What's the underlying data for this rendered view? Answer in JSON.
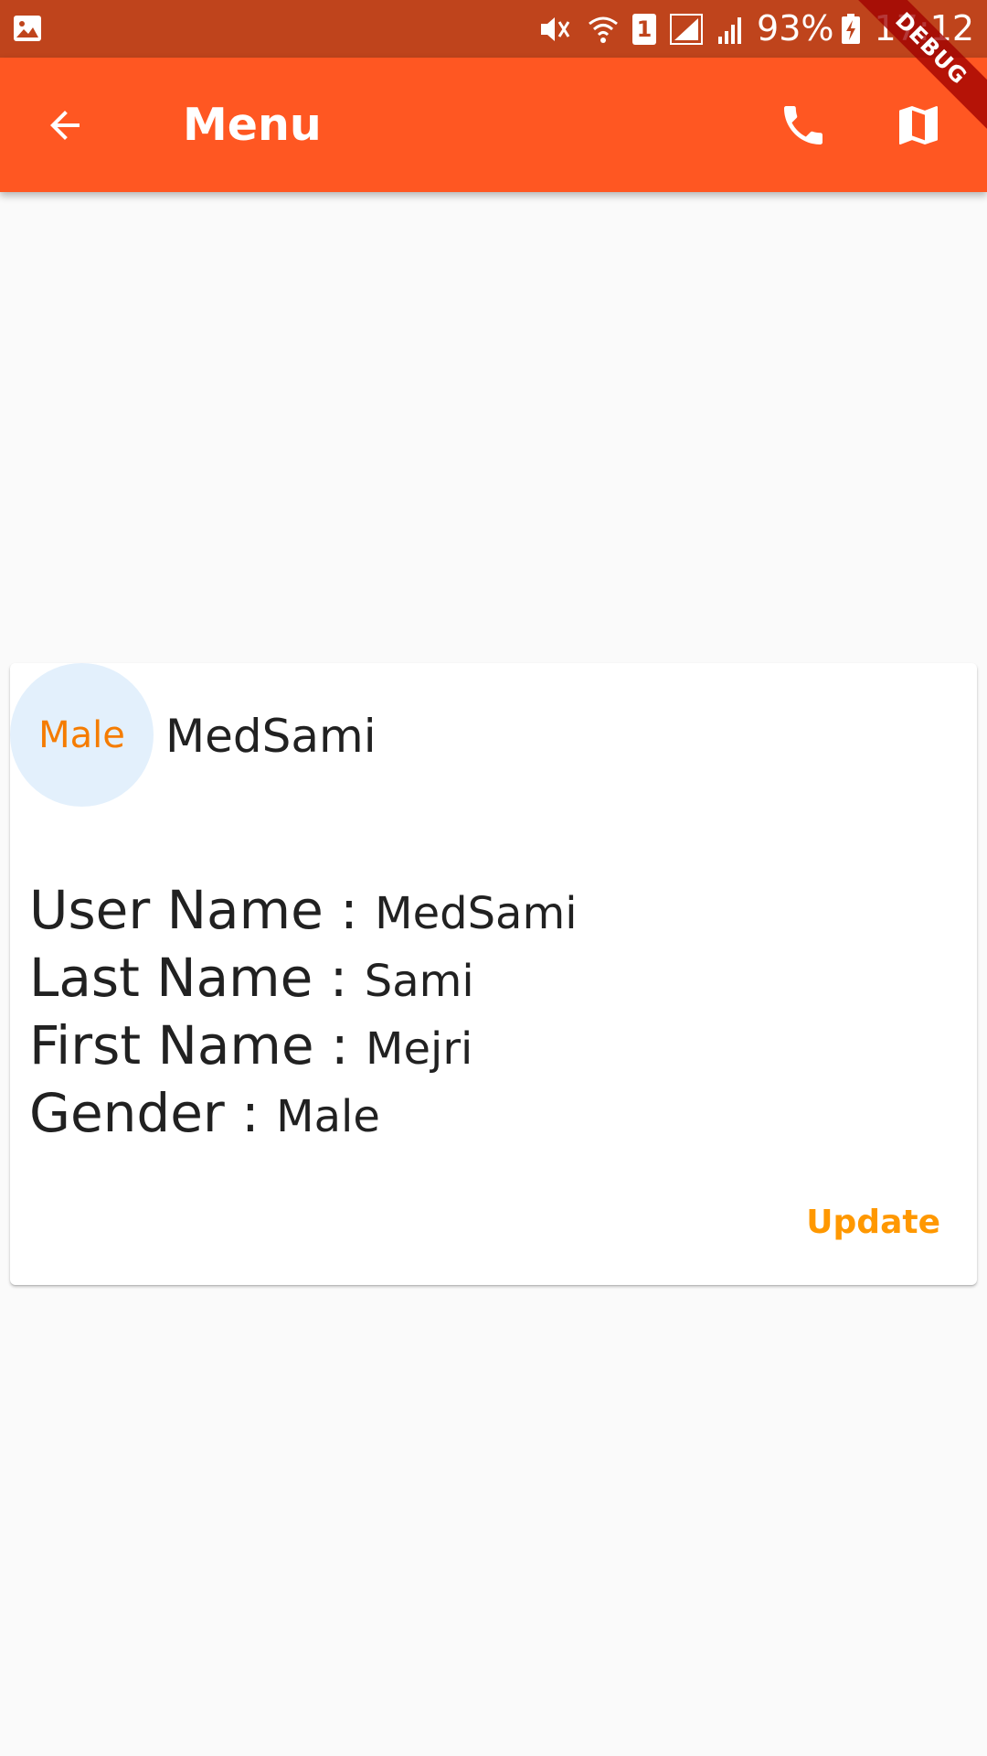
{
  "status_bar": {
    "battery": "93%",
    "sim_slot": "1",
    "time": "17:12",
    "icons": [
      "gallery-icon",
      "mute-icon",
      "wifi-icon",
      "sim-icon",
      "signal-icon",
      "signal-icon-2",
      "battery-charging-icon"
    ]
  },
  "app_bar": {
    "title": "Menu",
    "back_icon": "arrow-back-icon",
    "actions": [
      "phone-icon",
      "map-icon"
    ],
    "color": "#ff5722"
  },
  "debug_banner": {
    "label": "DEBUG"
  },
  "card": {
    "avatar_text": "Male",
    "name": "MedSami",
    "details": [
      {
        "label": "User Name : ",
        "value": "MedSami"
      },
      {
        "label": "Last Name : ",
        "value": "Sami"
      },
      {
        "label": "First Name : ",
        "value": "Mejri"
      },
      {
        "label": "Gender : ",
        "value": "Male"
      }
    ],
    "update_label": "Update",
    "accent_color": "#ff9800"
  }
}
